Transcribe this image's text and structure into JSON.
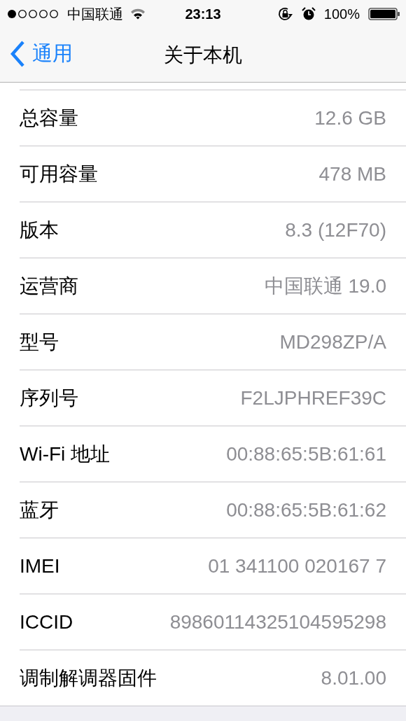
{
  "status_bar": {
    "carrier": "中国联通",
    "time": "23:13",
    "battery": "100%"
  },
  "nav": {
    "back": "通用",
    "title": "关于本机"
  },
  "rows": [
    {
      "label": "总容量",
      "value": "12.6 GB"
    },
    {
      "label": "可用容量",
      "value": "478 MB"
    },
    {
      "label": "版本",
      "value": "8.3 (12F70)"
    },
    {
      "label": "运营商",
      "value": "中国联通 19.0"
    },
    {
      "label": "型号",
      "value": "MD298ZP/A"
    },
    {
      "label": "序列号",
      "value": "F2LJPHREF39C"
    },
    {
      "label": "Wi-Fi 地址",
      "value": "00:88:65:5B:61:61"
    },
    {
      "label": "蓝牙",
      "value": "00:88:65:5B:61:62"
    },
    {
      "label": "IMEI",
      "value": "01 341100 020167 7"
    },
    {
      "label": "ICCID",
      "value": "89860114325104595298"
    },
    {
      "label": "调制解调器固件",
      "value": "8.01.00"
    }
  ]
}
